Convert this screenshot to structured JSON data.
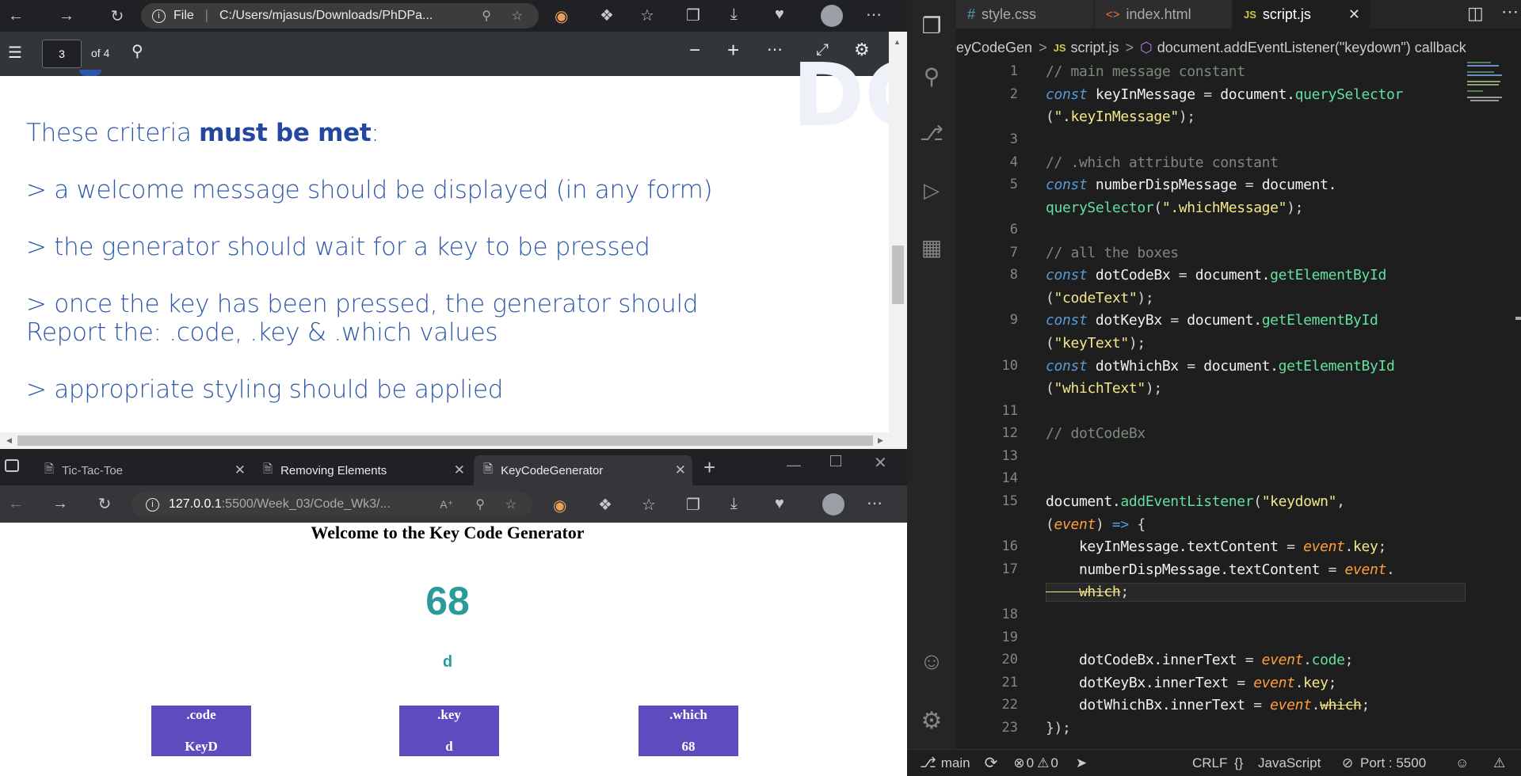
{
  "pdf_browser": {
    "address_prefix": "File",
    "address": "C:/Users/mjasus/Downloads/PhDPa...",
    "page_current": "3",
    "page_total": "of 4",
    "watermark": "DC",
    "lines": [
      {
        "pre": "These criteria ",
        "bold": "must be met",
        "post": ":"
      },
      {
        "text": "> a welcome message should be displayed (in any form)"
      },
      {
        "text": "> the generator should wait for a key to be pressed"
      },
      {
        "text": "> once the key has been pressed, the generator should"
      },
      {
        "text": "   Report the: .code, .key & .which values"
      },
      {
        "text": "> appropriate styling should be applied"
      }
    ]
  },
  "kc_browser": {
    "tabs": [
      {
        "label": "Tic-Tac-Toe"
      },
      {
        "label": "Removing Elements"
      },
      {
        "label": "KeyCodeGenerator"
      }
    ],
    "address_host": "127.0.0.1",
    "address_path": ":5500/Week_03/Code_Wk3/...",
    "page": {
      "title": "Welcome to the Key Code Generator",
      "number": "68",
      "key": "d",
      "boxes": [
        {
          "label": ".code",
          "value": "KeyD"
        },
        {
          "label": ".key",
          "value": "d"
        },
        {
          "label": ".which",
          "value": "68"
        }
      ]
    },
    "accent_color": "#2b9a9a",
    "box_color": "#5f4bbd"
  },
  "vscode": {
    "tabs": [
      {
        "icon": "#",
        "label": "style.css"
      },
      {
        "icon": "<>",
        "label": "index.html"
      },
      {
        "icon": "JS",
        "label": "script.js"
      }
    ],
    "breadcrumb": {
      "folder": "eyCodeGen",
      "sep1": ">",
      "file_icon": "JS",
      "file": "script.js",
      "sep2": ">",
      "symbol": "document.addEventListener(\"keydown\") callback"
    },
    "status": {
      "branch": "main",
      "errors": "0",
      "warnings": "0",
      "eol": "CRLF",
      "lang_icon": "{}",
      "language": "JavaScript",
      "port": "Port : 5500"
    },
    "line_numbers": [
      "1",
      "2",
      "3",
      "4",
      "5",
      "6",
      "7",
      "8",
      "9",
      "10",
      "11",
      "12",
      "13",
      "14",
      "15",
      "16",
      "17",
      "18",
      "19",
      "20",
      "21",
      "22",
      "23"
    ]
  }
}
